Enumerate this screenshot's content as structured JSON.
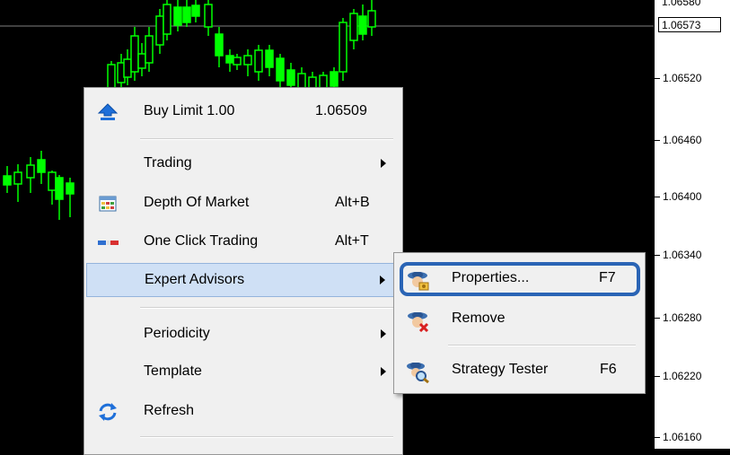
{
  "price_axis": {
    "current_price": "1.06573",
    "partial_top_label": "1.06580",
    "labels": [
      "1.06520",
      "1.06460",
      "1.06400",
      "1.06340",
      "1.06280",
      "1.06220",
      "1.06160"
    ]
  },
  "context_menu": {
    "buy_limit_label": "Buy Limit 1.00",
    "buy_limit_price": "1.06509",
    "trading_label": "Trading",
    "depth_of_market_label": "Depth Of Market",
    "depth_of_market_shortcut": "Alt+B",
    "one_click_trading_label": "One Click Trading",
    "one_click_trading_shortcut": "Alt+T",
    "expert_advisors_label": "Expert Advisors",
    "periodicity_label": "Periodicity",
    "template_label": "Template",
    "refresh_label": "Refresh"
  },
  "expert_advisors_submenu": {
    "properties_label": "Properties...",
    "properties_shortcut": "F7",
    "remove_label": "Remove",
    "strategy_tester_label": "Strategy Tester",
    "strategy_tester_shortcut": "F6"
  },
  "colors": {
    "chart_background": "#000000",
    "candle": "#00ff00",
    "menu_background": "#f0f0f0",
    "menu_highlight": "#cfe0f5",
    "focus_ring": "#2a64b5"
  },
  "icons": {
    "buy_limit": "blue-up-arrow-icon",
    "depth_of_market": "table-grid-icon",
    "one_click_trading": "red-blue-bar-icon",
    "refresh": "refresh-arrows-icon",
    "properties": "expert-properties-icon",
    "remove": "expert-remove-icon",
    "strategy_tester": "expert-magnifier-icon"
  }
}
